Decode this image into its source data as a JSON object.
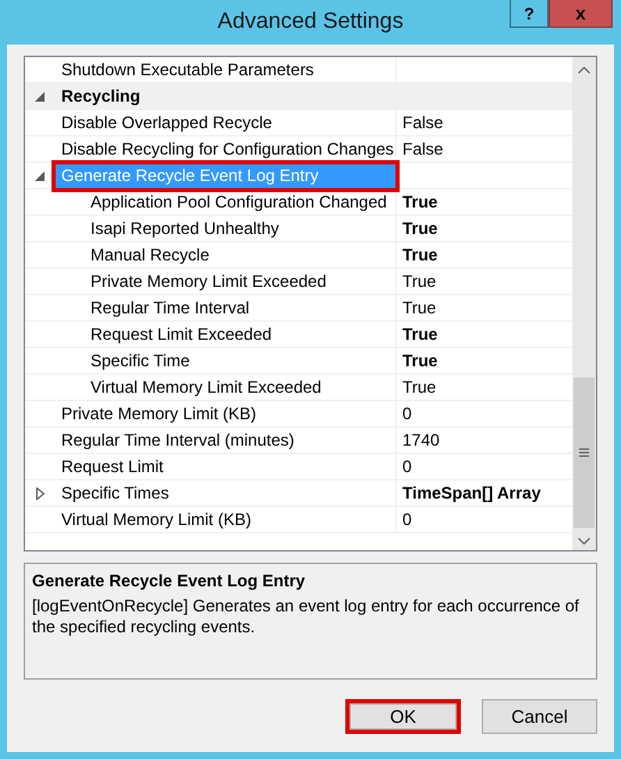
{
  "window": {
    "title": "Advanced Settings",
    "help": "?",
    "close": "x"
  },
  "rows": [
    {
      "kind": "property",
      "name": "Shutdown Executable Parameters",
      "selected": false
    },
    {
      "kind": "category",
      "name": "Recycling",
      "expanded": true,
      "children": [
        {
          "kind": "property",
          "name": "Disable Overlapped Recycle",
          "value": "False",
          "modified": false,
          "selected": false
        },
        {
          "kind": "property",
          "name": "Disable Recycling for Configuration Changes",
          "value": "False",
          "modified": false,
          "selected": false
        },
        {
          "kind": "property",
          "name": "Generate Recycle Event Log Entry",
          "selected": true,
          "highlighted": true,
          "expanded": true,
          "children": [
            {
              "kind": "property",
              "name": "Application Pool Configuration Changed",
              "value": "True",
              "modified": true,
              "selected": false
            },
            {
              "kind": "property",
              "name": "Isapi Reported Unhealthy",
              "value": "True",
              "modified": true,
              "selected": false
            },
            {
              "kind": "property",
              "name": "Manual Recycle",
              "value": "True",
              "modified": true,
              "selected": false
            },
            {
              "kind": "property",
              "name": "Private Memory Limit Exceeded",
              "value": "True",
              "modified": false,
              "selected": false
            },
            {
              "kind": "property",
              "name": "Regular Time Interval",
              "value": "True",
              "modified": false,
              "selected": false
            },
            {
              "kind": "property",
              "name": "Request Limit Exceeded",
              "value": "True",
              "modified": true,
              "selected": false
            },
            {
              "kind": "property",
              "name": "Specific Time",
              "value": "True",
              "modified": true,
              "selected": false
            },
            {
              "kind": "property",
              "name": "Virtual Memory Limit Exceeded",
              "value": "True",
              "modified": false,
              "selected": false
            }
          ]
        },
        {
          "kind": "property",
          "name": "Private Memory Limit (KB)",
          "value": "0",
          "modified": false,
          "selected": false
        },
        {
          "kind": "property",
          "name": "Regular Time Interval (minutes)",
          "value": "1740",
          "modified": false,
          "selected": false
        },
        {
          "kind": "property",
          "name": "Request Limit",
          "value": "0",
          "modified": false,
          "selected": false
        },
        {
          "kind": "property",
          "name": "Specific Times",
          "value": "TimeSpan[] Array",
          "modified": true,
          "selected": false,
          "expanded": false
        },
        {
          "kind": "property",
          "name": "Virtual Memory Limit (KB)",
          "value": "0",
          "modified": false,
          "selected": false
        }
      ]
    }
  ],
  "description": {
    "title": "Generate Recycle Event Log Entry",
    "text": "[logEventOnRecycle] Generates an event log entry for each occurrence of the specified recycling events."
  },
  "buttons": [
    {
      "label": "OK",
      "highlighted": true
    },
    {
      "label": "Cancel",
      "highlighted": false
    }
  ]
}
